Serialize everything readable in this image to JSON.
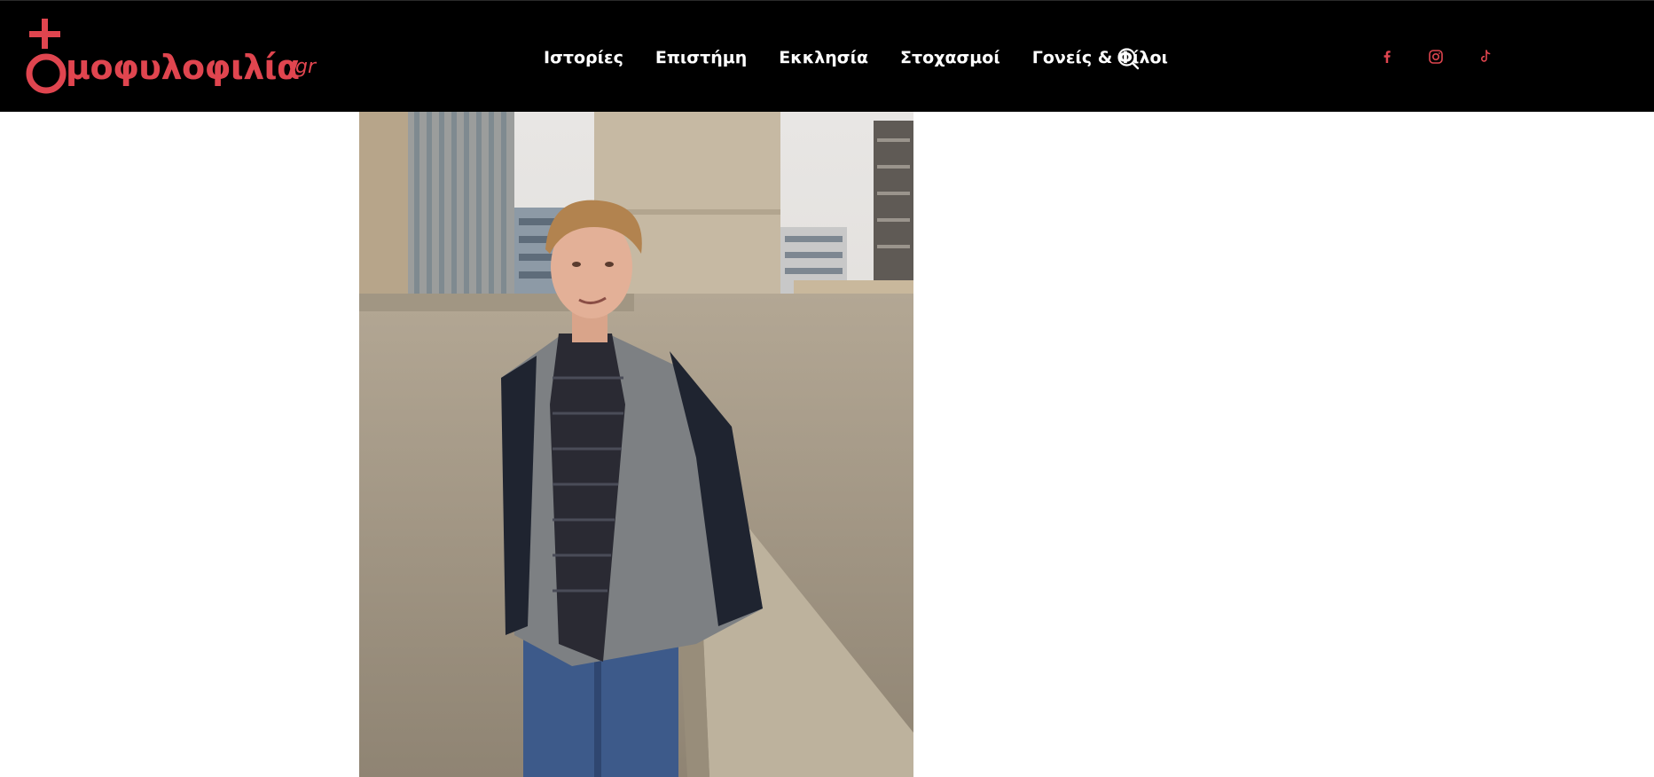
{
  "site": {
    "logo_text": "μοφυλοφιλία",
    "logo_suffix": ".gr",
    "brand_color": "#e0454f",
    "header_bg": "#000000"
  },
  "nav": {
    "items": [
      {
        "label": "Ιστορίες"
      },
      {
        "label": "Επιστήμη"
      },
      {
        "label": "Εκκλησία"
      },
      {
        "label": "Στοχασμοί"
      },
      {
        "label": "Γονείς & Φίλοι"
      }
    ],
    "search_icon": "search-icon"
  },
  "social": [
    {
      "icon": "facebook-icon"
    },
    {
      "icon": "instagram-icon"
    },
    {
      "icon": "tiktok-icon"
    }
  ],
  "article": {
    "featured_image": "young-man-gray-jacket-rooftop-photo"
  }
}
